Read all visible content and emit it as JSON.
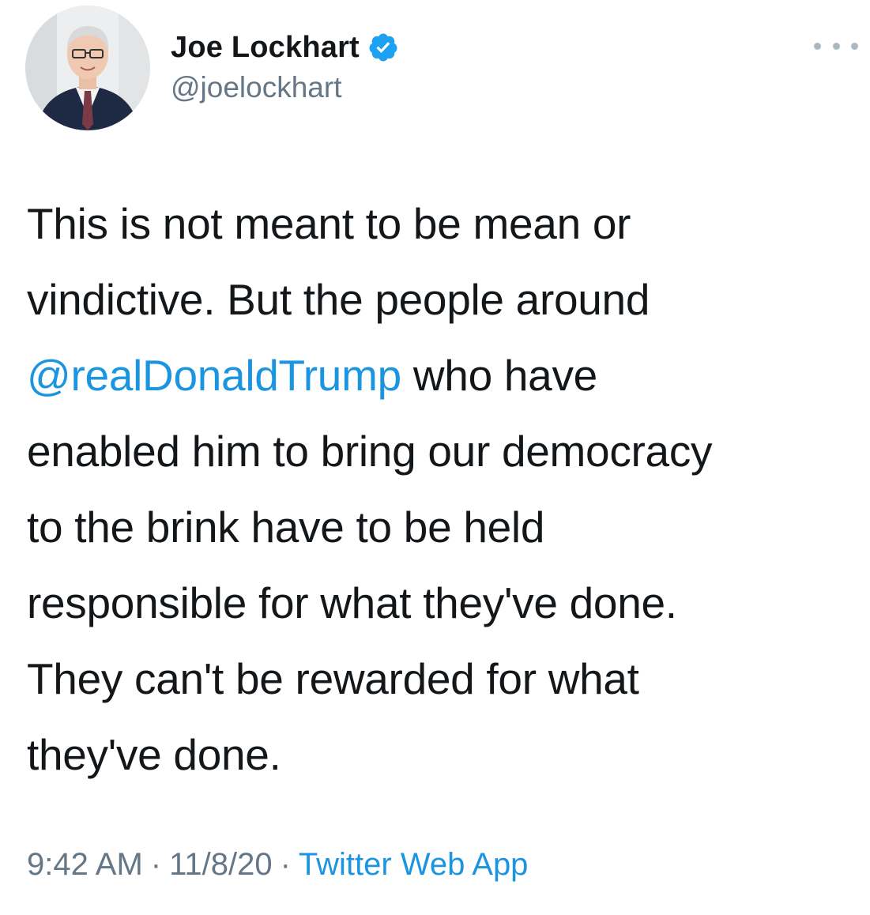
{
  "author": {
    "display_name": "Joe Lockhart",
    "handle": "@joelockhart",
    "verified": true,
    "avatar_icon": "profile-photo"
  },
  "tweet": {
    "lines": [
      {
        "text": "This is not meant to be mean or"
      },
      {
        "text": "vindictive. But the people around"
      },
      {
        "mention": "@realDonaldTrump",
        "text": " who have"
      },
      {
        "text": "enabled him to bring our democracy"
      },
      {
        "text": "to the brink have to be held"
      },
      {
        "text": "responsible for what they've done."
      },
      {
        "text": "They can't be rewarded for what"
      },
      {
        "text": "they've done."
      }
    ]
  },
  "meta": {
    "time": "9:42 AM",
    "date": "11/8/20",
    "separator": "·",
    "source": "Twitter Web App"
  },
  "colors": {
    "link": "#1b95e0",
    "secondary_text": "#657786",
    "primary_text": "#14171a",
    "verified_badge": "#1da1f2"
  },
  "icons": {
    "verified": "verified-badge-icon",
    "more": "more-options-icon"
  }
}
